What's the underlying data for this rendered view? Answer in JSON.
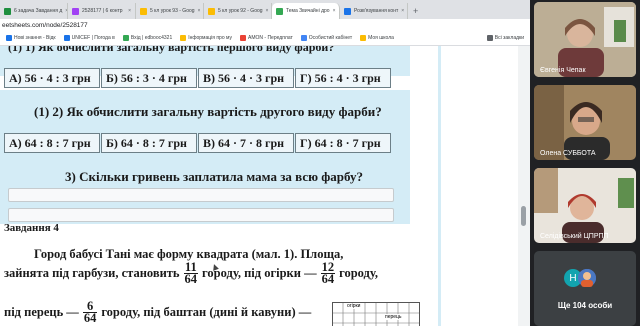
{
  "tabs": [
    {
      "label": "6 задача Завдання д",
      "favicon_color": "#1e8e3e",
      "active": false
    },
    {
      "label": "2528177 | 6 контр",
      "favicon_color": "#a142f4",
      "active": false
    },
    {
      "label": "5 кл урок 93 - Goog",
      "favicon_color": "#fbbc04",
      "active": false
    },
    {
      "label": "5 кл урок 92 - Goog",
      "favicon_color": "#fbbc04",
      "active": false
    },
    {
      "label": "Тема Звичайні дро",
      "favicon_color": "#34a853",
      "active": true
    },
    {
      "label": "Розв'язування конт",
      "favicon_color": "#1a73e8",
      "active": false
    }
  ],
  "new_tab": "+",
  "address": "eetsheets.com/node/2528177",
  "bookmarks": [
    {
      "label": "Нові знання - Відк",
      "color": "#1a73e8"
    },
    {
      "label": "UNICEF | Погода в",
      "color": "#1a73e8"
    },
    {
      "label": "Вхід | edbooc4321",
      "color": "#34a853"
    },
    {
      "label": "Інформація про му",
      "color": "#fbbc04"
    },
    {
      "label": "AMON - Передплат",
      "color": "#ea4335"
    },
    {
      "label": "Особистий кабінет",
      "color": "#4285f4"
    },
    {
      "label": "Моя школа",
      "color": "#fbbc04"
    }
  ],
  "all_bookmarks": "Всі закладки",
  "worksheet": {
    "top_partial": "(1)   1) Як обчислити загальну вартість першого виду фарби?",
    "row1": [
      "А) 56 · 4 : 3 грн",
      "Б) 56 : 3 · 4 грн",
      "В) 56 · 4 · 3 грн",
      "Г) 56 : 4 · 3 грн"
    ],
    "q2": "(1)    2) Як обчислити загальну вартість другого виду фарби?",
    "row2": [
      "А) 64 : 8 : 7 грн",
      "Б) 64 · 8 : 7 грн",
      "В) 64 · 7 · 8 грн",
      "Г) 64 : 8 · 7 грн"
    ],
    "q3": "3) Скільки гривень заплатила мама за всю фарбу?",
    "task_title": "Завдання 4",
    "p1": "Город бабусі Тані має форму квадрата (мал. 1). Площа,",
    "p2a": "зайнята під  гарбузи, становить",
    "f1": {
      "num": "11",
      "den": "64"
    },
    "p2b": "городу, під огірки —",
    "f2": {
      "num": "12",
      "den": "64"
    },
    "p2c": "городу,",
    "p3a": "під перець —",
    "f3": {
      "num": "6",
      "den": "64"
    },
    "p3b": "городу, під баштан (дині й кавуни) —",
    "figure_label": "огірки",
    "figure_label2": "перець"
  },
  "participants": [
    {
      "name": "Євгенія Чепак"
    },
    {
      "name": "Олена СУББОТА"
    },
    {
      "name": "Селідівський ЦПРПП"
    }
  ],
  "more": {
    "label": "Ще 104 особи",
    "avatar_letter": "Н"
  }
}
